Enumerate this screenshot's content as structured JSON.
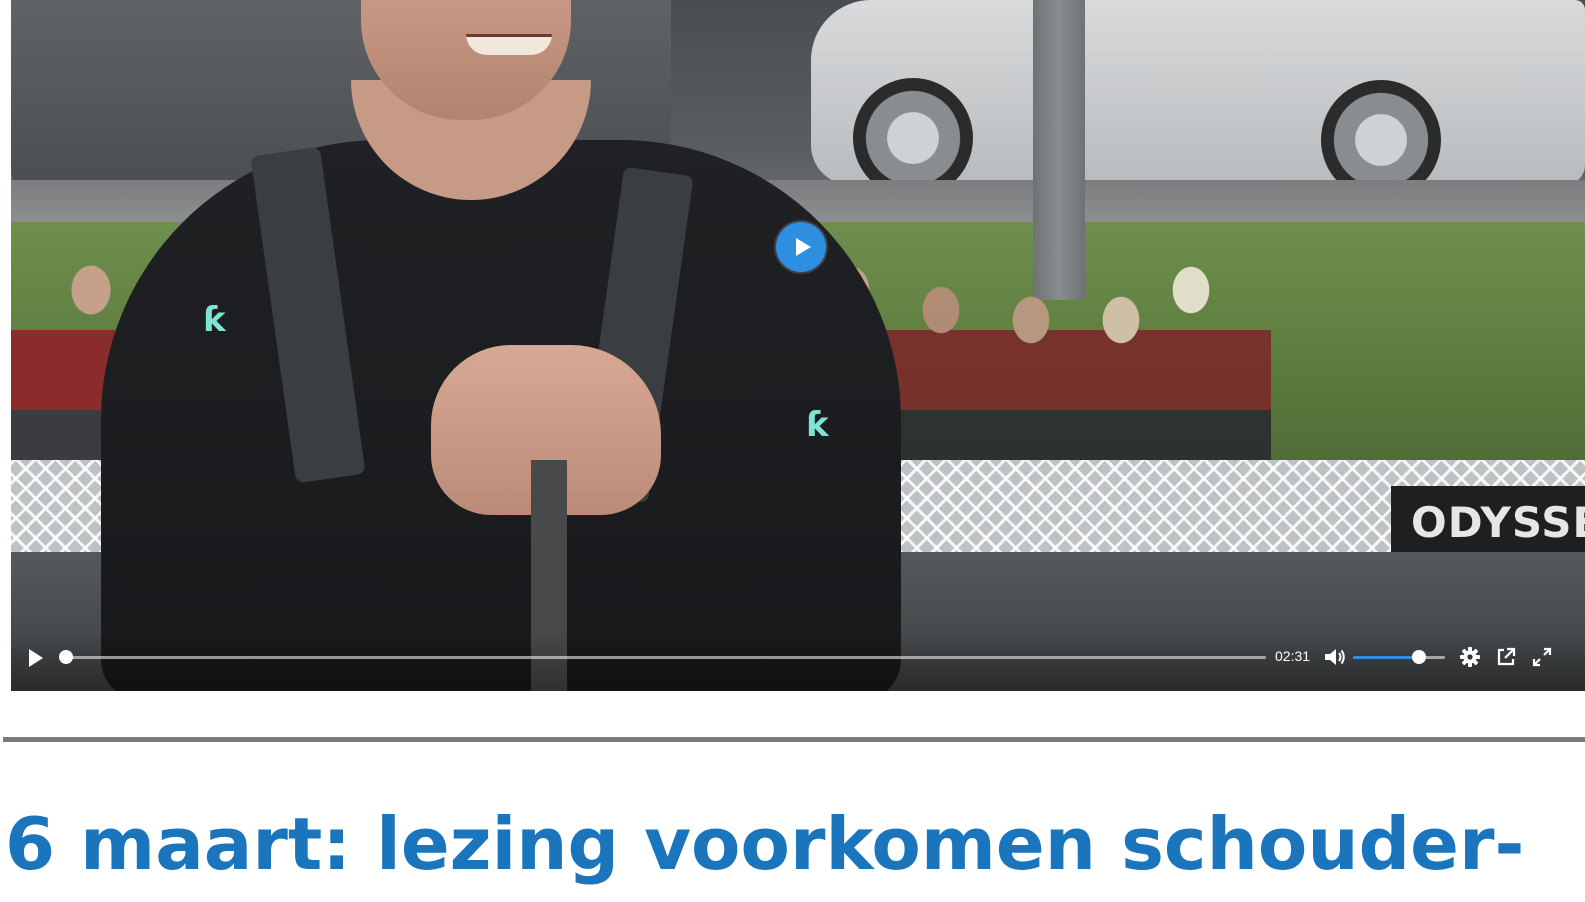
{
  "video": {
    "banner_text": "ODYSSEU",
    "big_play_icon": "play-icon",
    "controls": {
      "play_icon": "play-icon",
      "progress": 0.0,
      "time": "02:31",
      "volume_icon": "volume-icon",
      "volume_level": 0.72,
      "settings_icon": "gear-icon",
      "popout_icon": "external-link-icon",
      "fullscreen_icon": "fullscreen-icon"
    },
    "accent_color": "#2e8fe0"
  },
  "article": {
    "headline": "6 maart: lezing voorkomen schouder-",
    "headline_color": "#1a75bc"
  }
}
